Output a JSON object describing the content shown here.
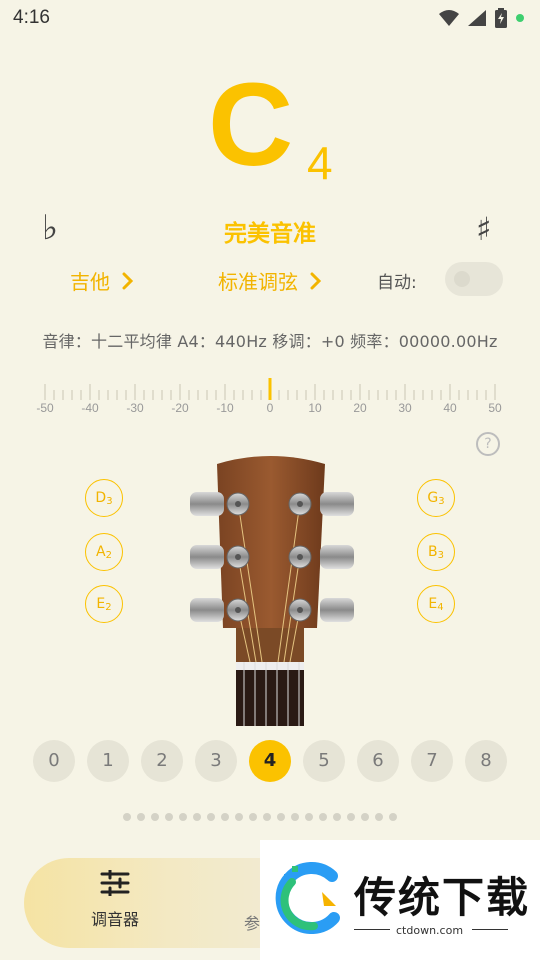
{
  "status_bar": {
    "time": "4:16"
  },
  "tuner": {
    "note": "C",
    "octave": "4",
    "flat_symbol": "♭",
    "sharp_symbol": "♯",
    "status": "完美音准"
  },
  "selectors": {
    "instrument": "吉他",
    "tuning": "标准调弦",
    "auto_label": "自动:",
    "auto_enabled": false
  },
  "info_line": "音律：十二平均律 A4：440Hz 移调：+0 频率：00000.00Hz",
  "scale": {
    "labels": [
      "-50",
      "-40",
      "-30",
      "-20",
      "-10",
      "0",
      "10",
      "20",
      "30",
      "40",
      "50"
    ],
    "needle_value": 0
  },
  "help_icon": "?",
  "strings": {
    "left": [
      {
        "note": "D",
        "octave": "3"
      },
      {
        "note": "A",
        "octave": "2"
      },
      {
        "note": "E",
        "octave": "2"
      }
    ],
    "right": [
      {
        "note": "G",
        "octave": "3"
      },
      {
        "note": "B",
        "octave": "3"
      },
      {
        "note": "E",
        "octave": "4"
      }
    ]
  },
  "octave_chips": [
    "0",
    "1",
    "2",
    "3",
    "4",
    "5",
    "6",
    "7",
    "8"
  ],
  "active_octave": "4",
  "bottom_nav": {
    "tuner_label": "调音器",
    "second_label_partial": "参"
  },
  "watermark": {
    "name": "传统下载",
    "url": "ctdown.com"
  },
  "colors": {
    "accent": "#fbc200",
    "background": "#f6f4e6",
    "status_dot": "#3ecf6f"
  }
}
